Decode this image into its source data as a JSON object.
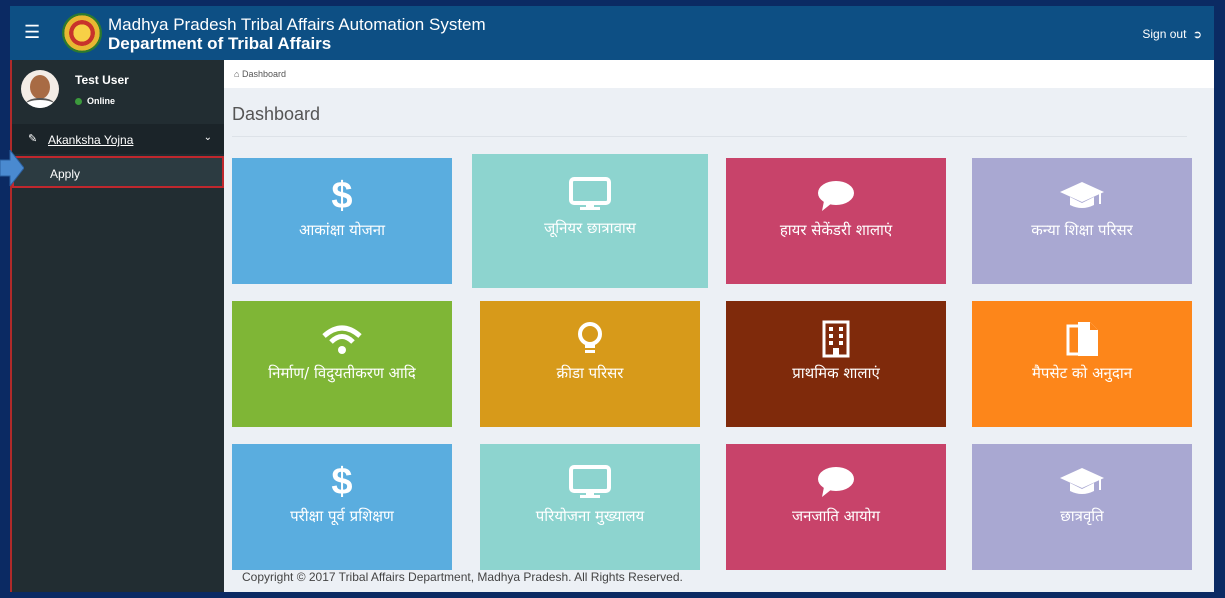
{
  "header": {
    "title_line1": "Madhya Pradesh Tribal Affairs Automation System",
    "title_line2": "Department of Tribal Affairs",
    "signout_label": "Sign out",
    "bg_color": "#0d4f84"
  },
  "sidebar": {
    "user_name": "Test User",
    "status": "Online",
    "menu_label": "Akanksha Yojna",
    "submenu_label": "Apply"
  },
  "breadcrumb": "Dashboard",
  "page_title": "Dashboard",
  "tiles": [
    {
      "label": "आकांक्षा योजना",
      "icon": "dollar-icon",
      "color": "#5aaddf"
    },
    {
      "label": "जूनियर छात्रावास",
      "icon": "monitor-icon",
      "color": "#8dd4cf"
    },
    {
      "label": "हायर सेकेंडरी शालाएं",
      "icon": "chat-icon",
      "color": "#c8436a"
    },
    {
      "label": "कन्या शिक्षा परिसर",
      "icon": "graduation-cap-icon",
      "color": "#a9a8d2"
    },
    {
      "label": "निर्माण/ विदुयतीकरण आदि",
      "icon": "wifi-icon",
      "color": "#7fb636"
    },
    {
      "label": "क्रीडा परिसर",
      "icon": "lightbulb-icon",
      "color": "#d79a1a"
    },
    {
      "label": "प्राथमिक शालाएं",
      "icon": "building-icon",
      "color": "#7f2a0b"
    },
    {
      "label": "मैपसेट को अनुदान",
      "icon": "document-icon",
      "color": "#fd861a"
    },
    {
      "label": "परीक्षा पूर्व प्रशिक्षण",
      "icon": "dollar-icon",
      "color": "#5aaddf"
    },
    {
      "label": "परियोजना मुख्यालय",
      "icon": "monitor-icon",
      "color": "#8dd4cf"
    },
    {
      "label": "जनजाति आयोग",
      "icon": "chat-icon",
      "color": "#c8436a"
    },
    {
      "label": "छात्रवृति",
      "icon": "graduation-cap-icon",
      "color": "#a9a8d2"
    }
  ],
  "footer": "Copyright © 2017 Tribal Affairs Department, Madhya Pradesh. All Rights Reserved."
}
